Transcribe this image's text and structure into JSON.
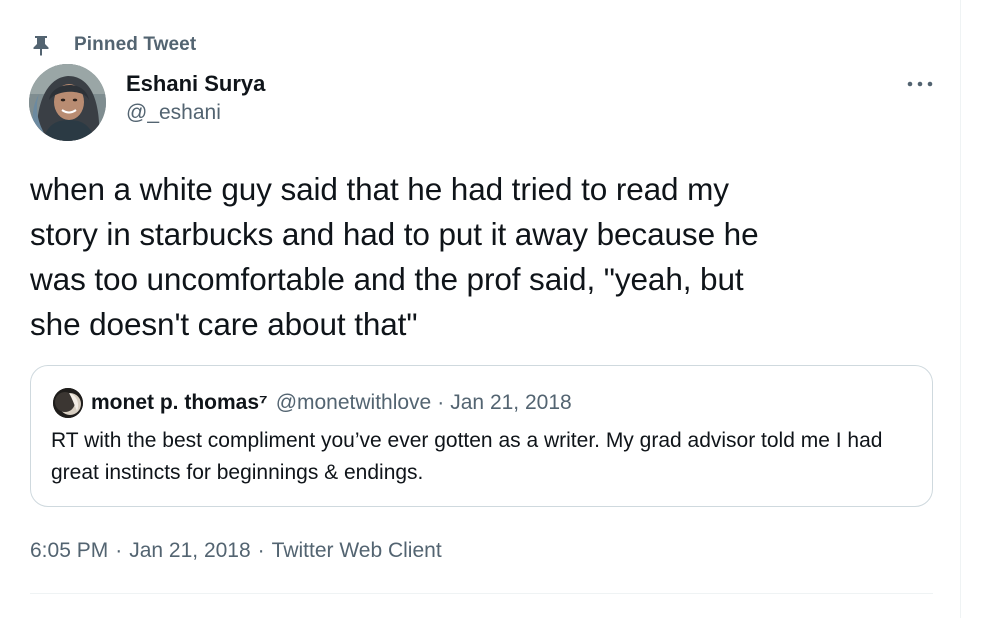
{
  "pinned": {
    "label": "Pinned Tweet",
    "icon": "pin-icon"
  },
  "author": {
    "name": "Eshani Surya",
    "handle": "@_eshani",
    "avatar_icon": "avatar-photo"
  },
  "more_icon": "more-horizontal-icon",
  "tweet": {
    "text": "when a white guy said that he had tried to read my\nstory in starbucks and had to put it away because he\nwas too uncomfortable and the prof said, \"yeah, but\nshe doesn't care about that\""
  },
  "quote": {
    "name": "monet p. thomas⁷",
    "handle": "@monetwithlove",
    "separator": "·",
    "date": "Jan 21, 2018",
    "text": "RT with the best compliment you’ve ever gotten as a writer. My grad advisor told me I had great instincts for beginnings & endings."
  },
  "meta": {
    "time": "6:05 PM",
    "separator": "·",
    "date": "Jan 21, 2018",
    "client": "Twitter Web Client"
  },
  "colors": {
    "text_primary": "#0f1419",
    "text_secondary": "#536471",
    "border": "#cfd9de",
    "divider": "#eff3f4"
  }
}
